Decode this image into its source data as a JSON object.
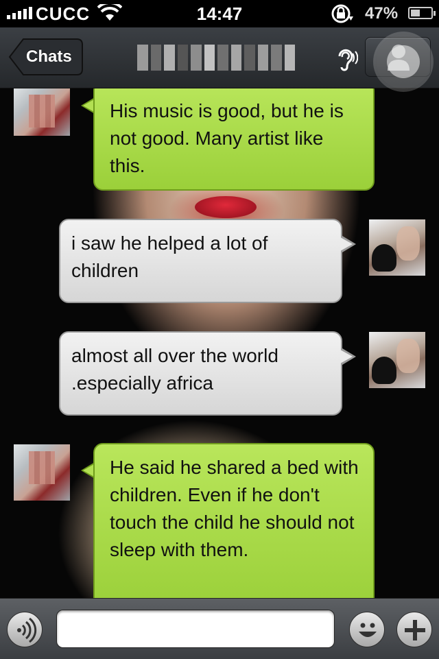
{
  "status_bar": {
    "carrier": "CUCC",
    "time": "14:47",
    "battery_percent": "47%",
    "battery_level": 0.47,
    "signal_icon": "signal-bars-icon",
    "wifi_icon": "wifi-icon",
    "lock_icon": "rotation-lock-icon"
  },
  "nav": {
    "back_label": "Chats",
    "title": "",
    "title_state": "blurred",
    "earpiece_icon": "earpiece-icon",
    "profile_icon": "contact-profile-icon"
  },
  "messages": [
    {
      "from": "friend",
      "text": "His music is good, but he is not good. Many artist like this."
    },
    {
      "from": "me",
      "text": "i saw he helped a lot of children"
    },
    {
      "from": "me",
      "text": "almost all over the world .especially africa"
    },
    {
      "from": "friend",
      "text": "He said he shared a bed with children. Even if he don't touch the child he should not sleep with them."
    }
  ],
  "input_bar": {
    "voice_icon": "voice-input-icon",
    "emoji_icon": "emoji-icon",
    "add_icon": "plus-icon",
    "message_value": ""
  },
  "colors": {
    "friend_bubble": "#9bd03a",
    "my_bubble": "#e4e4e4",
    "nav_bar": "#2f3236"
  }
}
